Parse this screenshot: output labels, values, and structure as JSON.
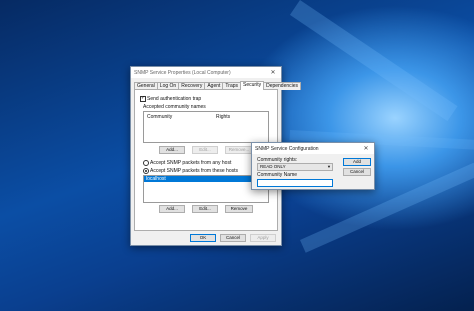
{
  "colors": {
    "accent": "#0078d7",
    "window_bg": "#f0f0f0",
    "desktop": "#0b4ea5"
  },
  "main_dialog": {
    "title": "SNMP Service Properties (Local Computer)",
    "tabs": [
      "General",
      "Log On",
      "Recovery",
      "Agent",
      "Traps",
      "Security",
      "Dependencies"
    ],
    "active_tab": "Security",
    "send_auth_trap_label": "Send authentication trap",
    "send_auth_trap_checked": true,
    "accepted_communities_label": "Accepted community names",
    "columns": {
      "community": "Community",
      "rights": "Rights"
    },
    "community_buttons": {
      "add": "Add...",
      "edit": "Edit...",
      "remove": "Remove..."
    },
    "accept_any_host_label": "Accept SNMP packets from any host",
    "accept_these_hosts_label": "Accept SNMP packets from these hosts",
    "hosts": [
      "localhost"
    ],
    "host_buttons": {
      "add": "Add...",
      "edit": "Edit...",
      "remove": "Remove"
    },
    "footer": {
      "ok": "OK",
      "cancel": "Cancel",
      "apply": "Apply"
    }
  },
  "config_dialog": {
    "title": "SNMP Service Configuration",
    "rights_label": "Community rights:",
    "rights_value": "READ ONLY",
    "name_label": "Community Name",
    "name_value": "",
    "add": "Add",
    "cancel": "Cancel"
  }
}
